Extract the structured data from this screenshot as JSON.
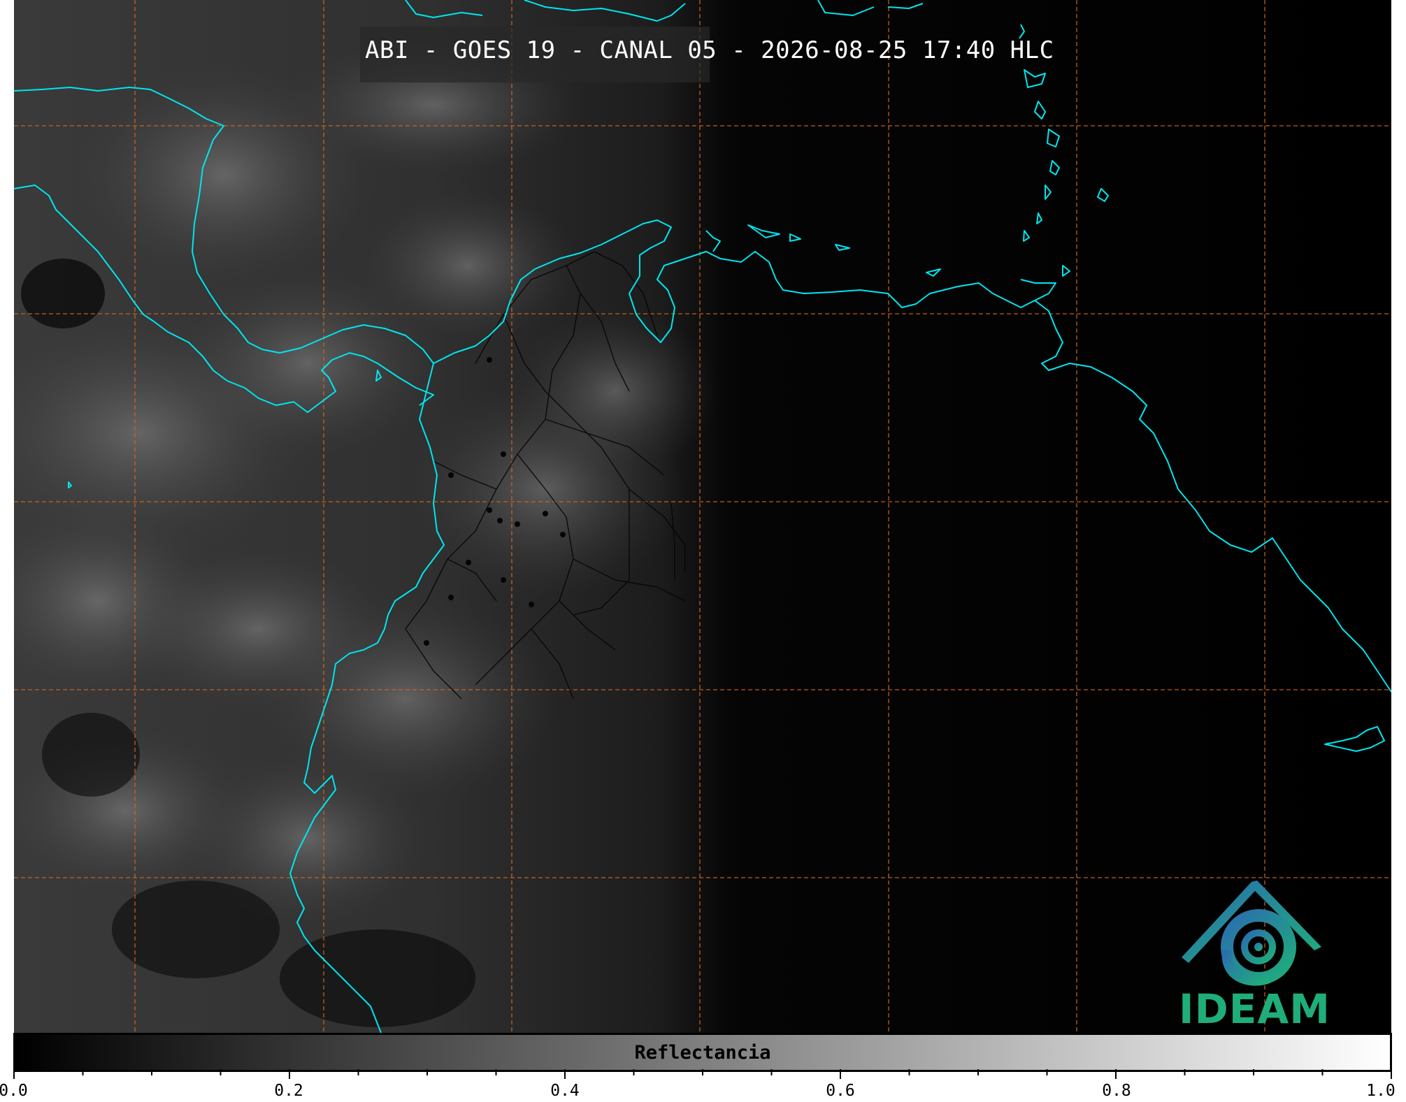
{
  "title": "ABI - GOES 19 - CANAL 05 - 2026-08-25 17:40 HLC",
  "logo_text": "IDEAM",
  "colorbar": {
    "label": "Reflectancia",
    "min": 0.0,
    "max": 1.0,
    "tick_labels": [
      "0.0",
      "0.2",
      "0.4",
      "0.6",
      "0.8",
      "1.0"
    ],
    "colormap": "greys"
  },
  "colors": {
    "coastline": "#00e5ee",
    "graticule": "#d2691e",
    "background": "#000000",
    "logo_green": "#1fae79",
    "logo_blue": "#2a6db0"
  },
  "map": {
    "graticule_style": "dashed",
    "features": [
      "coastlines",
      "administrative-boundaries",
      "cloud-reflectance"
    ]
  }
}
